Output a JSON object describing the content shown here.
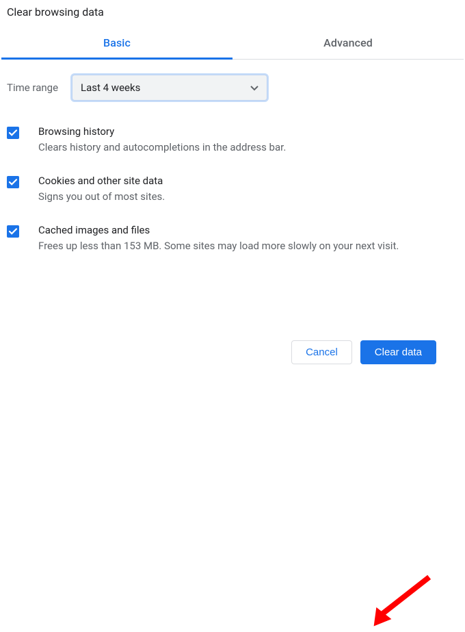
{
  "dialog": {
    "title": "Clear browsing data"
  },
  "tabs": {
    "basic": "Basic",
    "advanced": "Advanced"
  },
  "time_range": {
    "label": "Time range",
    "selected": "Last 4 weeks"
  },
  "options": [
    {
      "title": "Browsing history",
      "desc": "Clears history and autocompletions in the address bar.",
      "checked": true
    },
    {
      "title": "Cookies and other site data",
      "desc": "Signs you out of most sites.",
      "checked": true
    },
    {
      "title": "Cached images and files",
      "desc": "Frees up less than 153 MB. Some sites may load more slowly on your next visit.",
      "checked": true
    }
  ],
  "buttons": {
    "cancel": "Cancel",
    "clear": "Clear data"
  },
  "annotation": {
    "type": "arrow",
    "color": "#ff0000",
    "points_to": "clear-data-button"
  }
}
